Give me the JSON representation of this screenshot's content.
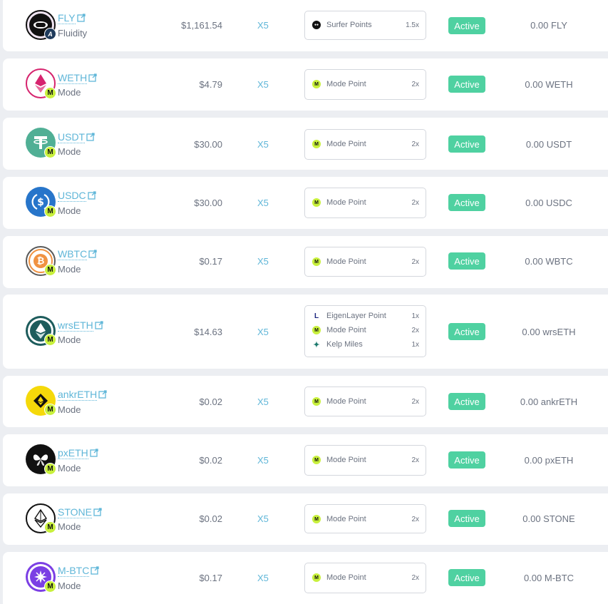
{
  "rows": [
    {
      "symbol": "FLY",
      "chain": "Fluidity",
      "price": "$1,161.54",
      "multiplier": "X5",
      "points": [
        {
          "icon": "surfer-icon",
          "name": "Surfer Points",
          "mult": "1.5x"
        }
      ],
      "status": "Active",
      "balance": "0.00 FLY",
      "logo": "fly-logo-icon",
      "badge": "fluidity-badge-icon"
    },
    {
      "symbol": "WETH",
      "chain": "Mode",
      "price": "$4.79",
      "multiplier": "X5",
      "points": [
        {
          "icon": "mode-icon",
          "name": "Mode Point",
          "mult": "2x"
        }
      ],
      "status": "Active",
      "balance": "0.00 WETH",
      "logo": "weth-logo-icon",
      "badge": "mode-badge-icon"
    },
    {
      "symbol": "USDT",
      "chain": "Mode",
      "price": "$30.00",
      "multiplier": "X5",
      "points": [
        {
          "icon": "mode-icon",
          "name": "Mode Point",
          "mult": "2x"
        }
      ],
      "status": "Active",
      "balance": "0.00 USDT",
      "logo": "usdt-logo-icon",
      "badge": "mode-badge-icon"
    },
    {
      "symbol": "USDC",
      "chain": "Mode",
      "price": "$30.00",
      "multiplier": "X5",
      "points": [
        {
          "icon": "mode-icon",
          "name": "Mode Point",
          "mult": "2x"
        }
      ],
      "status": "Active",
      "balance": "0.00 USDC",
      "logo": "usdc-logo-icon",
      "badge": "mode-badge-icon"
    },
    {
      "symbol": "WBTC",
      "chain": "Mode",
      "price": "$0.17",
      "multiplier": "X5",
      "points": [
        {
          "icon": "mode-icon",
          "name": "Mode Point",
          "mult": "2x"
        }
      ],
      "status": "Active",
      "balance": "0.00 WBTC",
      "logo": "wbtc-logo-icon",
      "badge": "mode-badge-icon"
    },
    {
      "symbol": "wrsETH",
      "chain": "Mode",
      "price": "$14.63",
      "multiplier": "X5",
      "points": [
        {
          "icon": "eigenlayer-icon",
          "name": "EigenLayer Point",
          "mult": "1x"
        },
        {
          "icon": "mode-icon",
          "name": "Mode Point",
          "mult": "2x"
        },
        {
          "icon": "kelp-icon",
          "name": "Kelp Miles",
          "mult": "1x"
        }
      ],
      "status": "Active",
      "balance": "0.00 wrsETH",
      "logo": "wrseth-logo-icon",
      "badge": "mode-badge-icon"
    },
    {
      "symbol": "ankrETH",
      "chain": "Mode",
      "price": "$0.02",
      "multiplier": "X5",
      "points": [
        {
          "icon": "mode-icon",
          "name": "Mode Point",
          "mult": "2x"
        }
      ],
      "status": "Active",
      "balance": "0.00 ankrETH",
      "logo": "ankreth-logo-icon",
      "badge": "mode-badge-icon"
    },
    {
      "symbol": "pxETH",
      "chain": "Mode",
      "price": "$0.02",
      "multiplier": "X5",
      "points": [
        {
          "icon": "mode-icon",
          "name": "Mode Point",
          "mult": "2x"
        }
      ],
      "status": "Active",
      "balance": "0.00 pxETH",
      "logo": "pxeth-logo-icon",
      "badge": "mode-badge-icon"
    },
    {
      "symbol": "STONE",
      "chain": "Mode",
      "price": "$0.02",
      "multiplier": "X5",
      "points": [
        {
          "icon": "mode-icon",
          "name": "Mode Point",
          "mult": "2x"
        }
      ],
      "status": "Active",
      "balance": "0.00 STONE",
      "logo": "stone-logo-icon",
      "badge": "mode-badge-icon"
    },
    {
      "symbol": "M-BTC",
      "chain": "Mode",
      "price": "$0.17",
      "multiplier": "X5",
      "points": [
        {
          "icon": "mode-icon",
          "name": "Mode Point",
          "mult": "2x"
        }
      ],
      "status": "Active",
      "balance": "0.00 M-BTC",
      "logo": "mbtc-logo-icon",
      "badge": "mode-badge-icon"
    }
  ],
  "badge_letters": {
    "mode": "M",
    "fluidity": "A"
  },
  "point_letters": {
    "mode": "M",
    "surfer": "●●",
    "eigenlayer": "L",
    "kelp": "✦"
  },
  "colors": {
    "accent": "#5fb6d8",
    "status_bg": "#4fd1a1",
    "mode_badge": "#c8f03c",
    "weth": "#d6246e",
    "usdt": "#50af95",
    "usdc": "#2775ca",
    "wbtc": "#f09242",
    "wrseth": "#1d5c5c",
    "ankreth": "#f5d90a",
    "pxeth": "#111111",
    "stone": "#111111",
    "mbtc": "#7b3fe4"
  }
}
